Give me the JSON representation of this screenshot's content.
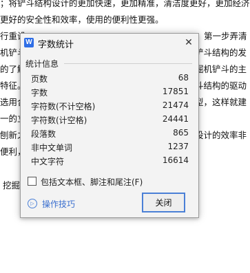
{
  "document": {
    "lines": [
      "；将铲斗结构设计的更加快速，更加精准，清洁度更好，更加经济",
      "更好的安全性和效率，使用的便利性更强。",
      "行重设",
      "机铲斗",
      "的了解",
      "特征。",
      "选用合",
      "一的立",
      "刨新之",
      "便利，",
      "挖掘"
    ],
    "right_fragments": [
      "第一步弄清",
      "铲斗结构的发",
      "掘机铲斗的主",
      "斗结构的驱动",
      "型，这样就建",
      "设计的效率非"
    ]
  },
  "dialog": {
    "title": "字数统计",
    "app_icon_letter": "W",
    "close_glyph": "✕",
    "section_heading": "统计信息",
    "stats": [
      {
        "label": "页数",
        "value": "68"
      },
      {
        "label": "字数",
        "value": "17851"
      },
      {
        "label": "字符数(不计空格)",
        "value": "21474"
      },
      {
        "label": "字符数(计空格)",
        "value": "24441"
      },
      {
        "label": "段落数",
        "value": "865"
      },
      {
        "label": "非中文单词",
        "value": "1237"
      },
      {
        "label": "中文字符",
        "value": "16614"
      }
    ],
    "checkbox_label": "包括文本框、脚注和尾注(F)",
    "checkbox_checked": false,
    "tips_label": "操作技巧",
    "tips_icon_glyph": "▷",
    "close_button_label": "关闭"
  }
}
